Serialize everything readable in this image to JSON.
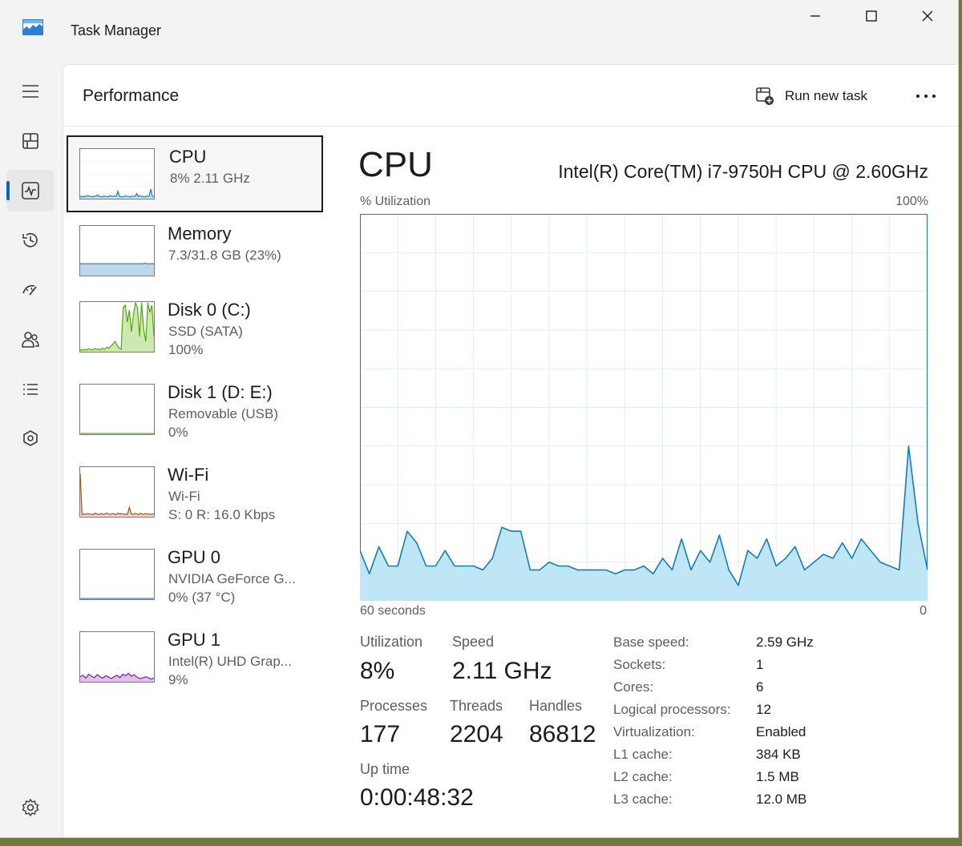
{
  "window": {
    "title": "Task Manager"
  },
  "header": {
    "title": "Performance",
    "run_new_task": "Run new task"
  },
  "devices": [
    {
      "name": "CPU",
      "sub1": "8%  2.11 GHz",
      "sub2": ""
    },
    {
      "name": "Memory",
      "sub1": "7.3/31.8 GB (23%)",
      "sub2": ""
    },
    {
      "name": "Disk 0 (C:)",
      "sub1": "SSD (SATA)",
      "sub2": "100%"
    },
    {
      "name": "Disk 1 (D: E:)",
      "sub1": "Removable (USB)",
      "sub2": "0%"
    },
    {
      "name": "Wi-Fi",
      "sub1": "Wi-Fi",
      "sub2": "S: 0  R: 16.0 Kbps"
    },
    {
      "name": "GPU 0",
      "sub1": "NVIDIA GeForce G...",
      "sub2": "0%  (37 °C)"
    },
    {
      "name": "GPU 1",
      "sub1": "Intel(R) UHD Grap...",
      "sub2": "9%"
    }
  ],
  "detail": {
    "title": "CPU",
    "model": "Intel(R) Core(TM) i7-9750H CPU @ 2.60GHz",
    "y_label": "% Utilization",
    "y_max": "100%",
    "x_left": "60 seconds",
    "x_right": "0"
  },
  "stats": {
    "utilization_label": "Utilization",
    "utilization_value": "8%",
    "speed_label": "Speed",
    "speed_value": "2.11 GHz",
    "processes_label": "Processes",
    "processes_value": "177",
    "threads_label": "Threads",
    "threads_value": "2204",
    "handles_label": "Handles",
    "handles_value": "86812",
    "uptime_label": "Up time",
    "uptime_value": "0:00:48:32"
  },
  "specs": [
    {
      "label": "Base speed:",
      "value": "2.59 GHz"
    },
    {
      "label": "Sockets:",
      "value": "1"
    },
    {
      "label": "Cores:",
      "value": "6"
    },
    {
      "label": "Logical processors:",
      "value": "12"
    },
    {
      "label": "Virtualization:",
      "value": "Enabled"
    },
    {
      "label": "L1 cache:",
      "value": "384 KB"
    },
    {
      "label": "L2 cache:",
      "value": "1.5 MB"
    },
    {
      "label": "L3 cache:",
      "value": "12.0 MB"
    }
  ],
  "colors": {
    "cpu_line": "#117dbb",
    "cpu_fill": "#bfe6f5",
    "memory_line": "#8b12ae",
    "disk_line": "#4da60c",
    "disk_fill": "#cde9b1",
    "wifi_line": "#a74f01",
    "accent": "#0067c0"
  },
  "chart_data": {
    "type": "area",
    "x": [
      60,
      59,
      58,
      57,
      56,
      55,
      54,
      53,
      52,
      51,
      50,
      49,
      48,
      47,
      46,
      45,
      44,
      43,
      42,
      41,
      40,
      39,
      38,
      37,
      36,
      35,
      34,
      33,
      32,
      31,
      30,
      29,
      28,
      27,
      26,
      25,
      24,
      23,
      22,
      21,
      20,
      19,
      18,
      17,
      16,
      15,
      14,
      13,
      12,
      11,
      10,
      9,
      8,
      7,
      6,
      5,
      4,
      3,
      2,
      1,
      0
    ],
    "series": [
      {
        "values": [
          13,
          7,
          14,
          9,
          9,
          18,
          15,
          9,
          9,
          13,
          9,
          9,
          9,
          8,
          11,
          19,
          18,
          18,
          8,
          8,
          10,
          9,
          9,
          8,
          8,
          8,
          8,
          7,
          8,
          8,
          9,
          7,
          11,
          8,
          16,
          8,
          13,
          10,
          17,
          8,
          4,
          13,
          11,
          16,
          9,
          11,
          14,
          8,
          10,
          12,
          11,
          15,
          11,
          16,
          13,
          10,
          9,
          8,
          40,
          20,
          8
        ]
      }
    ],
    "ylim": [
      0,
      100
    ],
    "xlabel": "60 seconds",
    "ylabel": "% Utilization"
  },
  "thumbs": {
    "cpu": [
      3,
      3,
      2,
      4,
      3,
      5,
      3,
      3,
      2,
      4,
      3,
      6,
      3,
      3,
      2,
      4,
      3,
      3,
      2,
      5,
      3,
      3,
      4,
      3,
      14,
      3,
      3,
      2,
      3,
      4,
      3,
      3,
      2,
      4,
      3,
      3,
      9,
      3,
      5,
      3,
      3,
      2,
      4,
      3,
      4,
      18,
      3,
      3
    ],
    "memory": [
      23,
      23,
      23,
      23,
      23,
      23,
      23,
      23,
      23,
      23,
      23,
      23,
      23,
      23,
      23,
      23,
      23,
      23,
      23,
      23,
      23,
      23,
      23,
      23,
      23,
      23,
      23,
      23,
      23,
      23,
      23,
      23,
      23,
      23,
      23,
      23,
      23,
      23,
      23,
      23,
      23,
      24,
      23,
      23,
      23,
      23,
      23,
      23
    ],
    "disk0": [
      2,
      2,
      3,
      2,
      4,
      3,
      2,
      5,
      3,
      4,
      2,
      6,
      3,
      8,
      5,
      10,
      14,
      20,
      12,
      6,
      3,
      90,
      95,
      60,
      85,
      40,
      75,
      100,
      90,
      30,
      100,
      45,
      20,
      100,
      80,
      95,
      30
    ],
    "disk1": [
      0,
      0,
      0,
      0,
      0,
      0,
      0,
      0,
      0,
      0,
      0,
      0,
      0,
      0,
      0,
      0,
      0,
      0,
      0,
      0
    ],
    "wifi": [
      88,
      3,
      4,
      3,
      5,
      3,
      4,
      3,
      6,
      4,
      3,
      5,
      3,
      4,
      6,
      4,
      3,
      5,
      4,
      3,
      6,
      4,
      5,
      3,
      4,
      3,
      18,
      4,
      3,
      5,
      4,
      3,
      6,
      3,
      4,
      5,
      3,
      4,
      3,
      5
    ],
    "gpu0": [
      0,
      0,
      0,
      0,
      0,
      0,
      0,
      0,
      0,
      0,
      0,
      0,
      0,
      0,
      0,
      0,
      0,
      0,
      0,
      0
    ],
    "gpu1": [
      9,
      12,
      6,
      14,
      10,
      7,
      13,
      9,
      6,
      11,
      8,
      5,
      9,
      12,
      7,
      14,
      11,
      16,
      10,
      13,
      8,
      5,
      6,
      9,
      7,
      4,
      6
    ]
  }
}
